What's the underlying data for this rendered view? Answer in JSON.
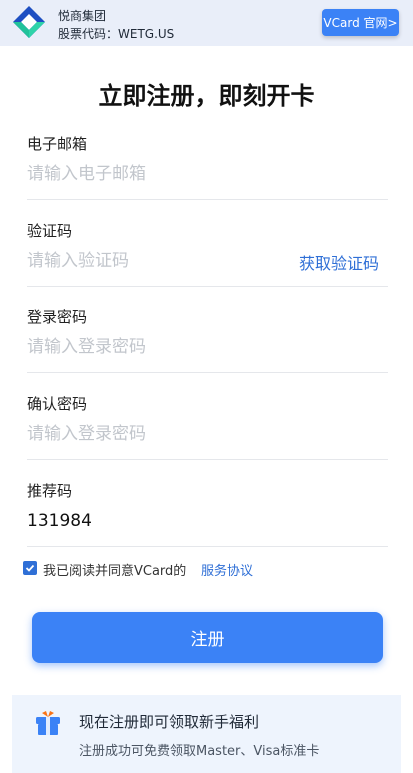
{
  "header": {
    "brand_name": "悦商集团",
    "stock_code": "股票代码：WETG.US",
    "official_site_button": "VCard 官网>"
  },
  "title": "立即注册，即刻开卡",
  "form": {
    "email": {
      "label": "电子邮箱",
      "placeholder": "请输入电子邮箱",
      "value": ""
    },
    "code": {
      "label": "验证码",
      "placeholder": "请输入验证码",
      "value": "",
      "get_code_label": "获取验证码"
    },
    "password": {
      "label": "登录密码",
      "placeholder": "请输入登录密码",
      "value": ""
    },
    "confirm": {
      "label": "确认密码",
      "placeholder": "请输入登录密码",
      "value": ""
    },
    "referral": {
      "label": "推荐码",
      "placeholder": "",
      "value": "131984"
    }
  },
  "agreement": {
    "checked": true,
    "text": "我已阅读并同意VCard的",
    "link": "服务协议"
  },
  "register_button": "注册",
  "promo": {
    "title": "现在注册即可领取新手福利",
    "subtitle": "注册成功可免费领取Master、Visa标准卡"
  },
  "colors": {
    "accent": "#3b82f6",
    "link": "#2f6fd6",
    "header_bg": "#e9eef9",
    "promo_bg": "#eef4fd"
  }
}
